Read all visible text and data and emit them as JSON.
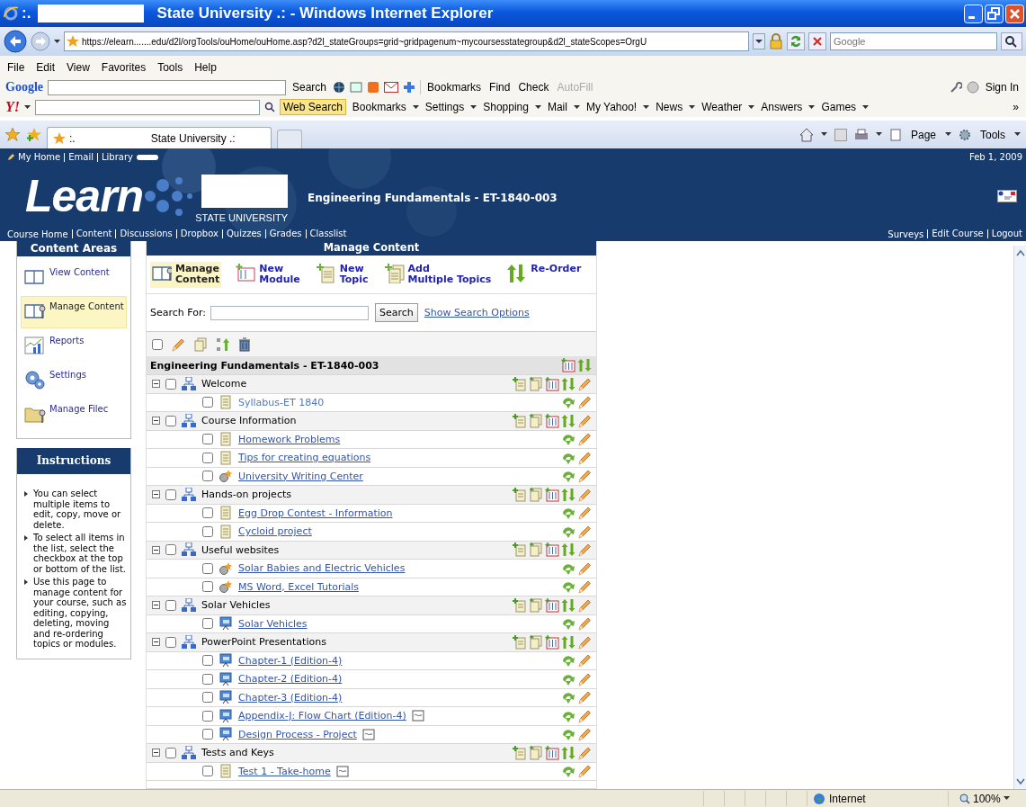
{
  "window": {
    "title_prefix": ":.",
    "title": "State University .: - Windows Internet Explorer"
  },
  "address_bar": {
    "url": "https://elearn.......edu/d2l/orgTools/ouHome/ouHome.asp?d2l_stateGroups=grid~gridpagenum~mycoursesstategroup&d2l_stateScopes=OrgU",
    "search_placeholder": "Google"
  },
  "menu_bar": [
    "File",
    "Edit",
    "View",
    "Favorites",
    "Tools",
    "Help"
  ],
  "google_toolbar": {
    "logo": "Google",
    "search_button": "Search",
    "items": [
      {
        "label": "Bookmarks",
        "disabled": false
      },
      {
        "label": "Find",
        "disabled": false
      },
      {
        "label": "Check",
        "disabled": false
      },
      {
        "label": "AutoFill",
        "disabled": true
      }
    ],
    "sign_in": "Sign In"
  },
  "yahoo_toolbar": {
    "logo": "Y!",
    "search_button": "Web Search",
    "items": [
      "Bookmarks",
      "Settings",
      "Shopping",
      "Mail",
      "My Yahoo!",
      "News",
      "Weather",
      "Answers",
      "Games"
    ],
    "more": "»"
  },
  "tab_bar": {
    "tab": {
      "prefix": ":.",
      "title": "State University .:"
    },
    "commands": [
      "Page",
      "Tools"
    ]
  },
  "page_header": {
    "top_links": [
      "My Home",
      "Email",
      "Library"
    ],
    "date": "Feb 1, 2009",
    "logo": "Learn",
    "university": "STATE UNIVERSITY",
    "course_title": "Engineering Fundamentals - ET-1840-003",
    "nav": [
      "Course Home",
      "Content",
      "Discussions",
      "Dropbox",
      "Quizzes",
      "Grades",
      "Classlist"
    ],
    "right_nav": [
      "Surveys",
      "Edit Course",
      "Logout"
    ]
  },
  "sidebar": {
    "title": "Content Areas",
    "items": [
      {
        "label": "View Content",
        "kind": "book",
        "selected": false
      },
      {
        "label": "Manage Content",
        "kind": "manage",
        "selected": true
      },
      {
        "label": "Reports",
        "kind": "chart",
        "selected": false
      },
      {
        "label": "Settings",
        "kind": "gears",
        "selected": false
      },
      {
        "label": "Manage Filec",
        "kind": "folder",
        "selected": false
      }
    ],
    "instructions": {
      "title": "Instructions",
      "items": [
        "You can select multiple items to edit, copy, move or delete.",
        "To select all items in the list, select the checkbox at the top or bottom of the list.",
        "Use this page to manage content for your course, such as editing, copying, deleting, moving and re-ordering topics or modules."
      ]
    }
  },
  "content": {
    "title": "Manage Content",
    "actions": [
      {
        "lines": [
          "Manage",
          "Content"
        ],
        "kind": "manage",
        "selected": true
      },
      {
        "lines": [
          "New",
          "Module"
        ],
        "kind": "module",
        "selected": false
      },
      {
        "lines": [
          "New",
          "Topic"
        ],
        "kind": "topic",
        "selected": false
      },
      {
        "lines": [
          "Add",
          "Multiple Topics"
        ],
        "kind": "topics",
        "selected": false
      },
      {
        "lines": [
          "Re-Order"
        ],
        "kind": "reorder",
        "selected": false
      }
    ],
    "search": {
      "label": "Search For:",
      "button": "Search",
      "options_link": "Show Search Options"
    },
    "select_all": {
      "checked": false
    },
    "root": "Engineering Fundamentals - ET-1840-003",
    "modules": [
      {
        "title": "Welcome",
        "expanded": true,
        "checked": false,
        "children": [
          {
            "title": "Syllabus-ET 1840",
            "kind": "document",
            "checked": false,
            "visited": true,
            "has_note": false
          }
        ]
      },
      {
        "title": "Course Information",
        "expanded": true,
        "checked": false,
        "children": [
          {
            "title": "Homework Problems",
            "kind": "document",
            "checked": false,
            "visited": false,
            "has_note": false
          },
          {
            "title": "Tips for creating equations",
            "kind": "document",
            "checked": false,
            "visited": false,
            "has_note": false
          },
          {
            "title": "University Writing Center",
            "kind": "link",
            "checked": false,
            "visited": false,
            "has_note": false
          }
        ]
      },
      {
        "title": "Hands-on projects",
        "expanded": true,
        "checked": false,
        "children": [
          {
            "title": "Egg Drop Contest - Information",
            "kind": "document",
            "checked": false,
            "visited": false,
            "has_note": false
          },
          {
            "title": "Cycloid project",
            "kind": "document",
            "checked": false,
            "visited": false,
            "has_note": false
          }
        ]
      },
      {
        "title": "Useful websites",
        "expanded": true,
        "checked": false,
        "children": [
          {
            "title": "Solar Babies and Electric Vehicles",
            "kind": "link",
            "checked": false,
            "visited": false,
            "has_note": false
          },
          {
            "title": "MS Word, Excel Tutorials",
            "kind": "link",
            "checked": false,
            "visited": false,
            "has_note": false
          }
        ]
      },
      {
        "title": "Solar Vehicles",
        "expanded": true,
        "checked": false,
        "children": [
          {
            "title": "Solar Vehicles",
            "kind": "presentation",
            "checked": false,
            "visited": false,
            "has_note": false
          }
        ]
      },
      {
        "title": "PowerPoint Presentations",
        "expanded": true,
        "checked": false,
        "children": [
          {
            "title": "Chapter-1 (Edition-4)",
            "kind": "presentation",
            "checked": false,
            "visited": false,
            "has_note": false
          },
          {
            "title": "Chapter-2 (Edition-4)",
            "kind": "presentation",
            "checked": false,
            "visited": false,
            "has_note": false
          },
          {
            "title": "Chapter-3 (Edition-4)",
            "kind": "presentation",
            "checked": false,
            "visited": false,
            "has_note": false
          },
          {
            "title": "Appendix-J: Flow Chart (Edition-4)",
            "kind": "presentation",
            "checked": false,
            "visited": false,
            "has_note": true
          },
          {
            "title": "Design Process - Project",
            "kind": "presentation",
            "checked": false,
            "visited": false,
            "has_note": true
          }
        ]
      },
      {
        "title": "Tests and Keys",
        "expanded": true,
        "checked": false,
        "children": [
          {
            "title": "Test 1 - Take-home",
            "kind": "document",
            "checked": false,
            "visited": false,
            "has_note": true
          }
        ]
      }
    ]
  },
  "status_bar": {
    "zone": "Internet",
    "zoom": "100%"
  }
}
